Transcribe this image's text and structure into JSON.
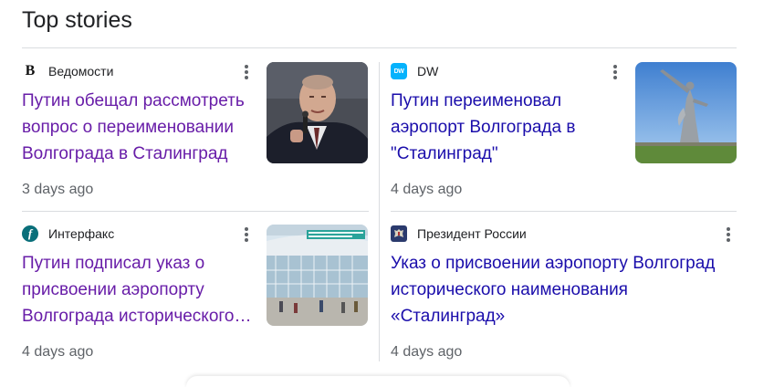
{
  "section": {
    "title": "Top stories"
  },
  "stories": [
    {
      "source": "Ведомости",
      "favicon_glyph": "В",
      "headline": "Путин обещал рассмотреть вопрос о переименовании Волгограда в Сталинград",
      "time": "3 days ago",
      "visited": true
    },
    {
      "source": "DW",
      "favicon_glyph": "DW",
      "headline": "Путин переименовал аэропорт Волгограда в \"Сталинград\"",
      "time": "4 days ago",
      "visited": false
    },
    {
      "source": "Интерфакс",
      "favicon_glyph": "f",
      "headline": "Путин подписал указ о присвоении аэропорту Волгограда исторического наименования «Сталинград»",
      "time": "4 days ago",
      "visited": true
    },
    {
      "source": "Президент России",
      "favicon_glyph": "",
      "headline": "Указ о присвоении аэропорту Волгоград исторического наименования «Сталинград»",
      "time": "4 days ago",
      "visited": false
    }
  ],
  "colors": {
    "visited_link": "#681da8",
    "link": "#1a0dab",
    "meta_text": "#5f6368",
    "divider": "#dadce0"
  },
  "icons": [
    "more-vert-icon",
    "vedomosti-logo",
    "dw-logo",
    "interfax-logo",
    "kremlin-emblem"
  ]
}
